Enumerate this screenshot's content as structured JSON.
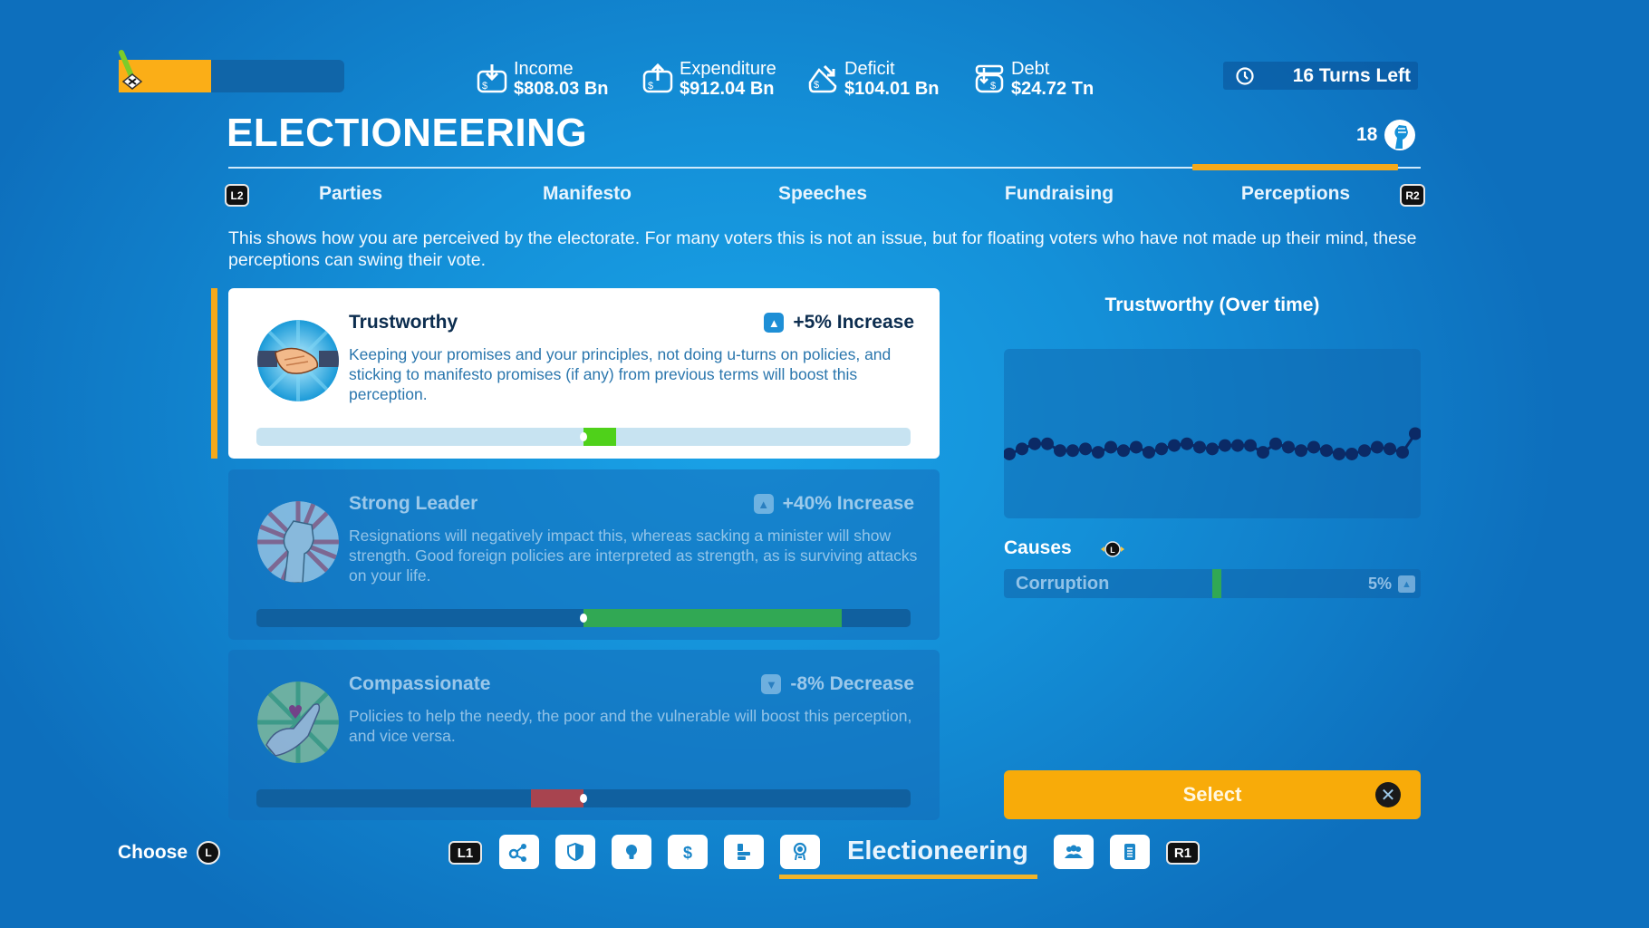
{
  "header": {
    "progress_fraction": 0.41,
    "stats": [
      {
        "icon": "income-icon",
        "label": "Income",
        "value": "$808.03 Bn"
      },
      {
        "icon": "expenditure-icon",
        "label": "Expenditure",
        "value": "$912.04 Bn"
      },
      {
        "icon": "deficit-icon",
        "label": "Deficit",
        "value": "$104.01 Bn"
      },
      {
        "icon": "debt-icon",
        "label": "Debt",
        "value": "$24.72 Tn"
      }
    ],
    "turns_left": "16 Turns Left",
    "title": "ELECTIONEERING",
    "political_capital": "18"
  },
  "tabs": {
    "left_shoulder": "L2",
    "right_shoulder": "R2",
    "items": [
      {
        "label": "Parties",
        "active": false
      },
      {
        "label": "Manifesto",
        "active": false
      },
      {
        "label": "Speeches",
        "active": false
      },
      {
        "label": "Fundraising",
        "active": false
      },
      {
        "label": "Perceptions",
        "active": true
      }
    ]
  },
  "description": "This shows how you are perceived by the electorate. For many voters this is not an issue, but for floating voters who have not made up their mind, these perceptions can swing their vote.",
  "perceptions": [
    {
      "name": "Trustworthy",
      "change": "+5% Increase",
      "direction": "up",
      "description": "Keeping your promises and your principles, not doing u-turns on policies, and sticking to manifesto promises (if any) from previous terms will boost this perception.",
      "value": 0.1,
      "color": "#4fd11a",
      "selected": true
    },
    {
      "name": "Strong Leader",
      "change": "+40% Increase",
      "direction": "up",
      "description": "Resignations will negatively impact this, whereas sacking a minister will show strength. Good foreign policies are interpreted as strength, as is surviving attacks on your life.",
      "value": 0.79,
      "color": "#31a854",
      "selected": false
    },
    {
      "name": "Compassionate",
      "change": "-8% Decrease",
      "direction": "down",
      "description": "Policies to help the needy, the poor and the vulnerable will boost this perception, and vice versa.",
      "value": -0.16,
      "color": "#a8444f",
      "selected": false
    }
  ],
  "chart_data": {
    "type": "line",
    "title": "Trustworthy (Over time)",
    "xlabel": "",
    "ylabel": "",
    "grid": false,
    "ylim": [
      0,
      100
    ],
    "x": [
      1,
      2,
      3,
      4,
      5,
      6,
      7,
      8,
      9,
      10,
      11,
      12,
      13,
      14,
      15,
      16,
      17,
      18,
      19,
      20,
      21,
      22,
      23,
      24,
      25,
      26,
      27,
      28,
      29,
      30,
      31,
      32,
      33
    ],
    "series": [
      {
        "name": "Trustworthy",
        "color": "#0b2a66",
        "values": [
          38,
          41,
          44,
          44,
          40,
          40,
          41,
          39,
          42,
          40,
          42,
          39,
          41,
          43,
          44,
          42,
          41,
          43,
          43,
          43,
          39,
          44,
          42,
          40,
          42,
          40,
          38,
          38,
          40,
          42,
          41,
          39,
          50
        ]
      }
    ]
  },
  "causes": {
    "label": "Causes",
    "stick_glyph": "L",
    "items": [
      {
        "name": "Corruption",
        "percent": "5%",
        "direction": "up"
      }
    ]
  },
  "select_button": {
    "label": "Select",
    "button_glyph": "✕"
  },
  "footer": {
    "choose_label": "Choose",
    "choose_glyph": "L",
    "left_shoulder": "L1",
    "right_shoulder": "R1",
    "active_label": "Electioneering",
    "icons": [
      "share-network-icon",
      "shield-icon",
      "lightbulb-icon",
      "dollar-icon",
      "chart-icon",
      "rosette-icon",
      "people-icon",
      "document-icon"
    ]
  }
}
